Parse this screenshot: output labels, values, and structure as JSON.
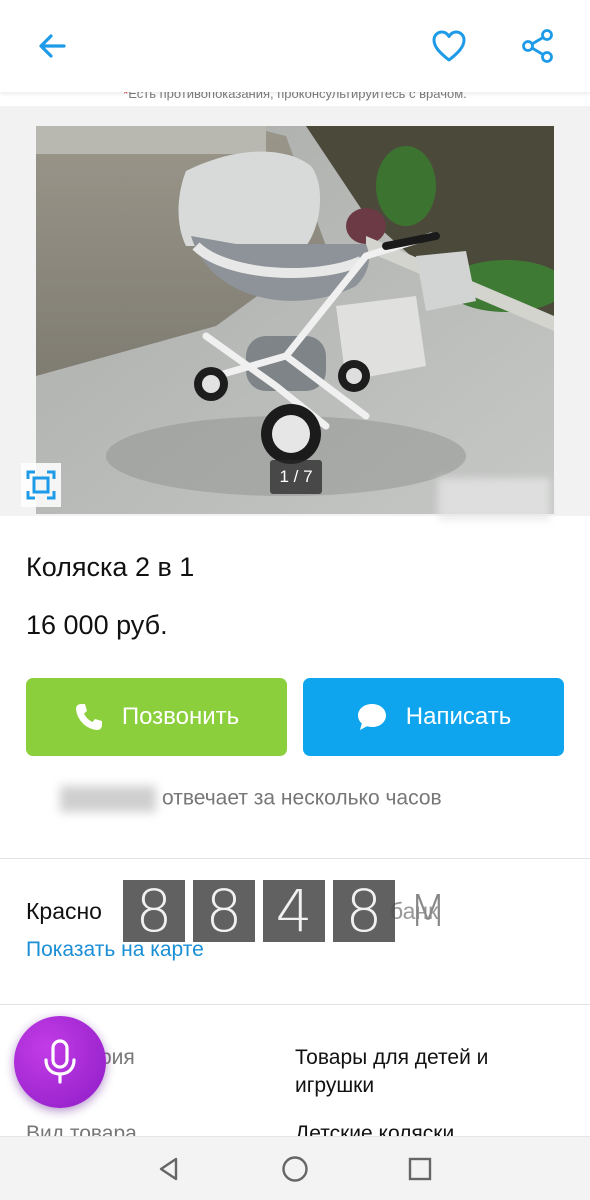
{
  "header": {
    "back_icon": "arrow-left-icon",
    "favorite_icon": "heart-icon",
    "share_icon": "share-icon",
    "accent_color": "#1e9be8"
  },
  "disclaimer": {
    "star": "*",
    "text": "Есть противопоказания, проконсультируйтесь с врачом."
  },
  "gallery": {
    "counter": "1 / 7",
    "fullscreen_icon": "fullscreen-icon"
  },
  "listing": {
    "title": "Коляска 2 в 1",
    "price": "16 000 руб."
  },
  "actions": {
    "call_label": "Позвонить",
    "call_color": "#8ccf3c",
    "message_label": "Написать",
    "message_color": "#0ea5ee"
  },
  "seller": {
    "responds_text": "отвечает за несколько часов"
  },
  "location": {
    "address_visible": "Красно",
    "address_suffix": "банк",
    "map_link": "Показать на карте"
  },
  "overlay": {
    "digits": [
      "8",
      "8",
      "4",
      "8"
    ],
    "unit": "M"
  },
  "params": {
    "row1_label": "рия",
    "row1_value": "Товары для детей и игрушки",
    "row2_label": "Вид товара",
    "row2_value": "Детские коляски"
  },
  "voice": {
    "mic_icon": "microphone-icon",
    "color": "#a52bd6"
  },
  "system_nav": {
    "back_icon": "nav-back-triangle-icon",
    "home_icon": "nav-home-circle-icon",
    "recent_icon": "nav-recent-square-icon"
  }
}
